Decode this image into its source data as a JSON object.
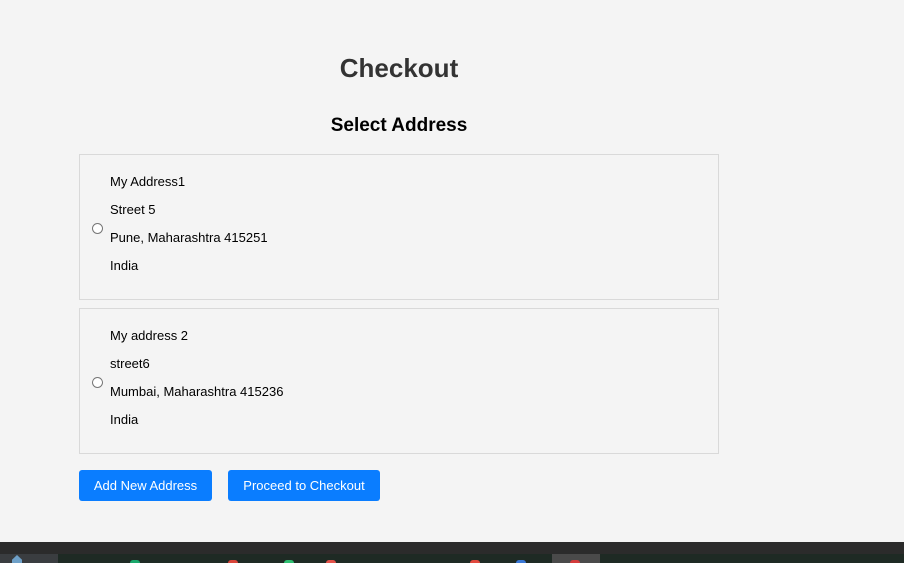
{
  "page": {
    "title": "Checkout",
    "section_title": "Select Address"
  },
  "addresses": [
    {
      "name": "My Address1",
      "street": "Street 5",
      "city_line": "Pune, Maharashtra 415251",
      "country": "India",
      "selected": false
    },
    {
      "name": "My address 2",
      "street": "street6",
      "city_line": "Mumbai, Maharashtra 415236",
      "country": "India",
      "selected": false
    }
  ],
  "actions": {
    "add_label": "Add New Address",
    "proceed_label": "Proceed to Checkout"
  },
  "colors": {
    "accent": "#0a7dff",
    "background": "#f4f4f4",
    "card_border": "#d9d9d9",
    "taskbar": "#2b2b2b"
  }
}
